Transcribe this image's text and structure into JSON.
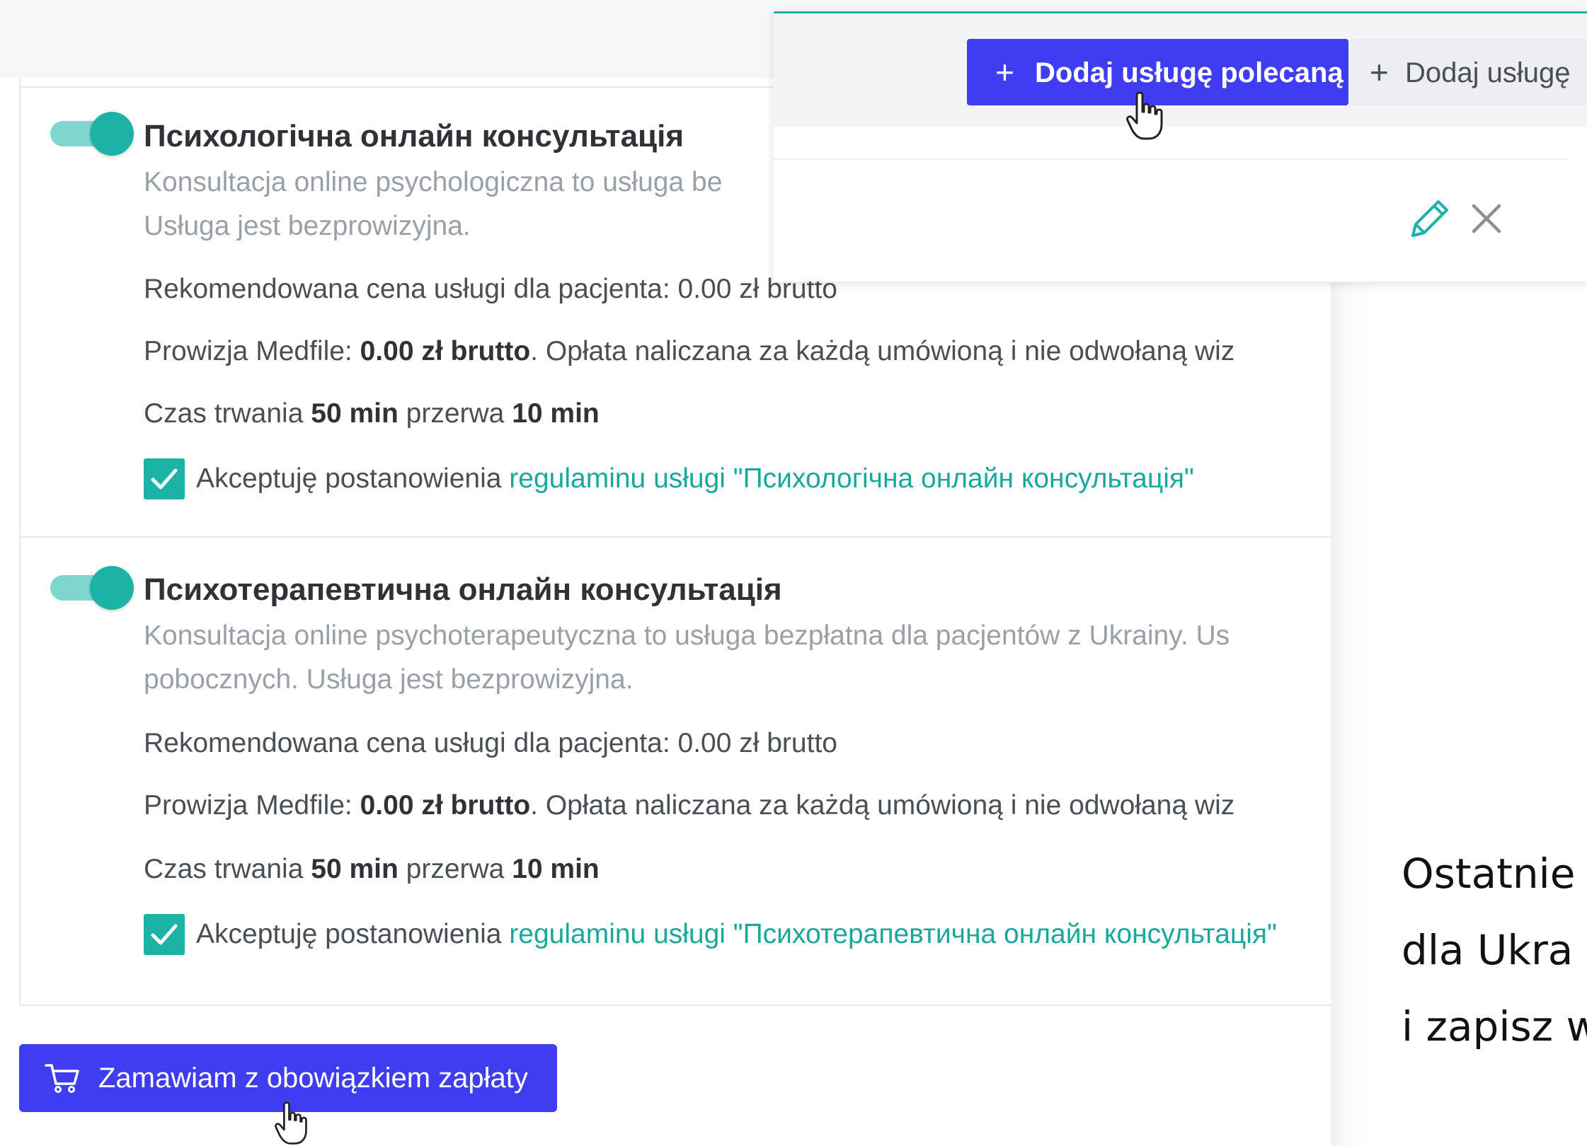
{
  "popup": {
    "add_recommended_label": "Dodaj usługę polecaną",
    "add_service_label": "Dodaj usługę"
  },
  "services": [
    {
      "title": "Психологічна онлайн консультація",
      "desc_line1": "Konsultacja online psychologiczna to usługa be",
      "desc_line2": "Usługa jest bezprowizyjna.",
      "price_text": "Rekomendowana cena usługi dla pacjenta: 0.00 zł brutto",
      "commission_prefix": "Prowizja Medfile: ",
      "commission_value": "0.00 zł brutto",
      "commission_suffix": ". Opłata naliczana za każdą umówioną i nie odwołaną wiz",
      "duration_prefix": "Czas trwania ",
      "duration_value": "50 min",
      "break_prefix": " przerwa ",
      "break_value": "10 min",
      "accept_prefix": "Akceptuję postanowienia ",
      "accept_link": "regulaminu usługi \"Психологічна онлайн консультація\"",
      "enabled": true,
      "accepted": true
    },
    {
      "title": "Психотерапевтична онлайн консультація",
      "desc_line1": "Konsultacja online psychoterapeutyczna to usługa bezpłatna dla pacjentów z Ukrainy. Us",
      "desc_line2": "pobocznych. Usługa jest bezprowizyjna.",
      "price_text": "Rekomendowana cena usługi dla pacjenta: 0.00 zł brutto",
      "commission_prefix": "Prowizja Medfile: ",
      "commission_value": "0.00 zł brutto",
      "commission_suffix": ". Opłata naliczana za każdą umówioną i nie odwołaną wiz",
      "duration_prefix": "Czas trwania ",
      "duration_value": "50 min",
      "break_prefix": " przerwa ",
      "break_value": "10 min",
      "accept_prefix": "Akceptuję postanowienia ",
      "accept_link": "regulaminu usługi \"Психотерапевтична онлайн консультація\"",
      "enabled": true,
      "accepted": true
    }
  ],
  "order_button": {
    "label": "Zamawiam z obowiązkiem zapłaty"
  },
  "caption": {
    "line1": "Ostatnie",
    "line2": "dla Ukra",
    "line3": "i zapisz w"
  },
  "colors": {
    "accent_teal": "#1cb3a6",
    "primary_blue": "#3e3df2",
    "link_teal": "#1aa89c"
  },
  "icons": [
    "plus-icon",
    "pencil-icon",
    "close-icon",
    "cart-icon",
    "hand-pointer-icon",
    "checkmark-icon"
  ]
}
